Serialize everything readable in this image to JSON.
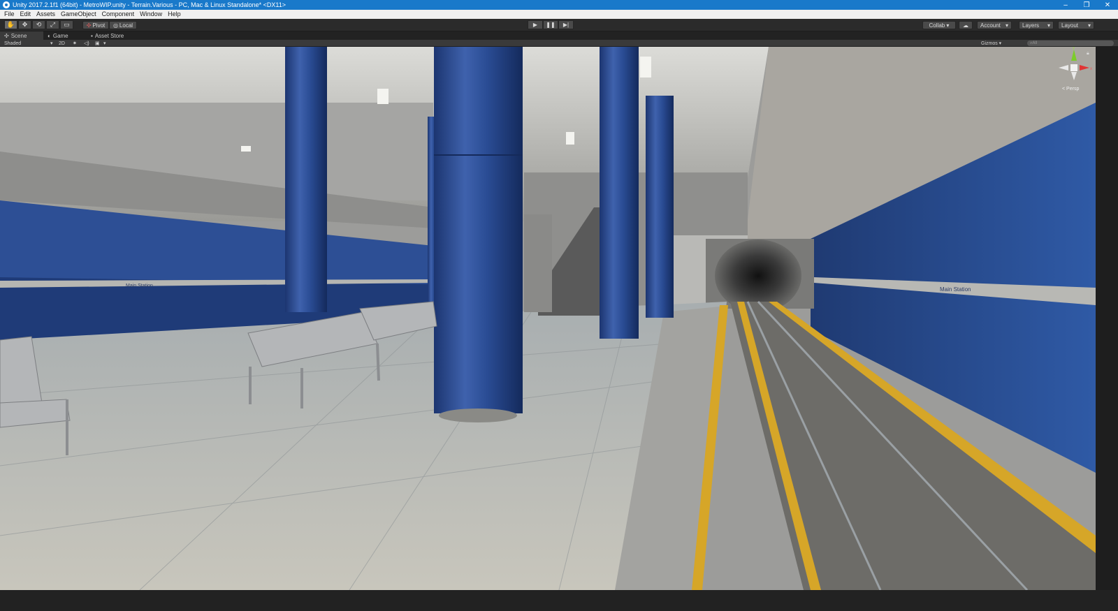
{
  "window": {
    "title": "Unity 2017.2.1f1 (64bit) - MetroWIP.unity - Terrain.Various - PC, Mac & Linux Standalone* <DX11>",
    "controls": [
      "–",
      "❐",
      "✕"
    ]
  },
  "menu": [
    "File",
    "Edit",
    "Assets",
    "GameObject",
    "Component",
    "Window",
    "Help"
  ],
  "toolbar": {
    "tools": [
      "hand-icon",
      "move-icon",
      "rotate-icon",
      "scale-icon",
      "rect-icon"
    ],
    "tool_glyphs": [
      "✋",
      "✥",
      "⟲",
      "⤢",
      "▭"
    ],
    "pivot_label": "Pivot",
    "local_label": "Local",
    "play_glyphs": [
      "▶",
      "❚❚",
      "▶|"
    ],
    "collab_label": "Collab ▾",
    "cloud_glyph": "☁",
    "account_label": "Account",
    "layers_label": "Layers",
    "layout_label": "Layout"
  },
  "tabs": {
    "scene": "Scene",
    "game": "Game",
    "asset_store": "Asset Store"
  },
  "scene_toolbar": {
    "shading": "Shaded",
    "mode_2d": "2D",
    "gizmos": "Gizmos",
    "search_placeholder": "All"
  },
  "viewport": {
    "sign_left": "Main Station",
    "sign_right": "Main Station",
    "projection": "Persp",
    "gizmo_y": "y",
    "gizmo_x": "x"
  }
}
